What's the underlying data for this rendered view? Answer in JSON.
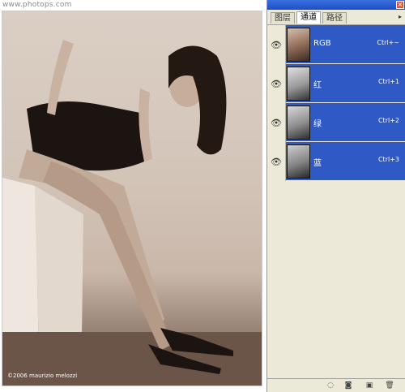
{
  "watermark": "www.photops.com",
  "photo": {
    "credit": "©2006 maurizio melozzi"
  },
  "panel": {
    "tabs": [
      {
        "label": "图层",
        "active": false
      },
      {
        "label": "通道",
        "active": true
      },
      {
        "label": "路径",
        "active": false
      }
    ],
    "menu_icon": "panel-menu-arrow",
    "channels": [
      {
        "name": "RGB",
        "shortcut": "Ctrl+~",
        "thumb": "color"
      },
      {
        "name": "红",
        "shortcut": "Ctrl+1",
        "thumb": "gray"
      },
      {
        "name": "绿",
        "shortcut": "Ctrl+2",
        "thumb": "gray"
      },
      {
        "name": "蓝",
        "shortcut": "Ctrl+3",
        "thumb": "gray"
      }
    ],
    "footer_buttons": [
      {
        "icon": "load-selection-icon",
        "glyph": "◌"
      },
      {
        "icon": "save-selection-icon",
        "glyph": "◙"
      },
      {
        "icon": "new-channel-icon",
        "glyph": "▣"
      },
      {
        "icon": "trash-icon",
        "glyph": "🗑"
      }
    ],
    "colors": {
      "selected_row": "#2f59c5",
      "panel_bg": "#ece9d8",
      "titlebar": "#1d4fc4"
    }
  }
}
